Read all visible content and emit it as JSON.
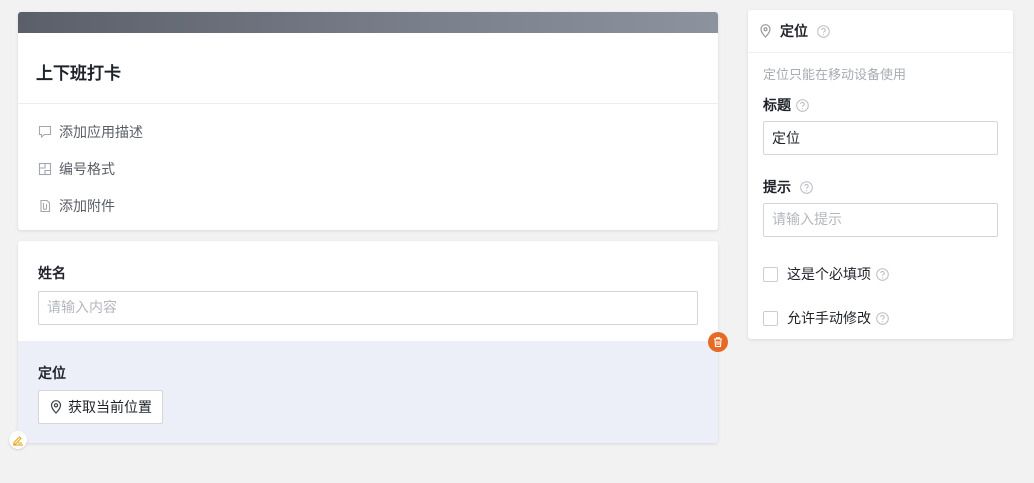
{
  "form_header": {
    "title": "上下班打卡",
    "links": [
      {
        "icon": "comment-icon",
        "label": "添加应用描述"
      },
      {
        "icon": "numbering-icon",
        "label": "编号格式"
      },
      {
        "icon": "attachment-icon",
        "label": "添加附件"
      }
    ]
  },
  "form_fields": {
    "name": {
      "label": "姓名",
      "placeholder": "请输入内容"
    },
    "location": {
      "label": "定位",
      "button_label": "获取当前位置"
    }
  },
  "settings_panel": {
    "title": "定位",
    "note": "定位只能在移动设备使用",
    "title_field": {
      "label": "标题",
      "value": "定位"
    },
    "hint_field": {
      "label": "提示",
      "placeholder": "请输入提示"
    },
    "required_checkbox": {
      "label": "这是个必填项"
    },
    "manual_edit_checkbox": {
      "label": "允许手动修改"
    }
  },
  "colors": {
    "accent_delete": "#e56a25",
    "selected_field_bg": "#eceef8",
    "banner": "#6b717c"
  }
}
